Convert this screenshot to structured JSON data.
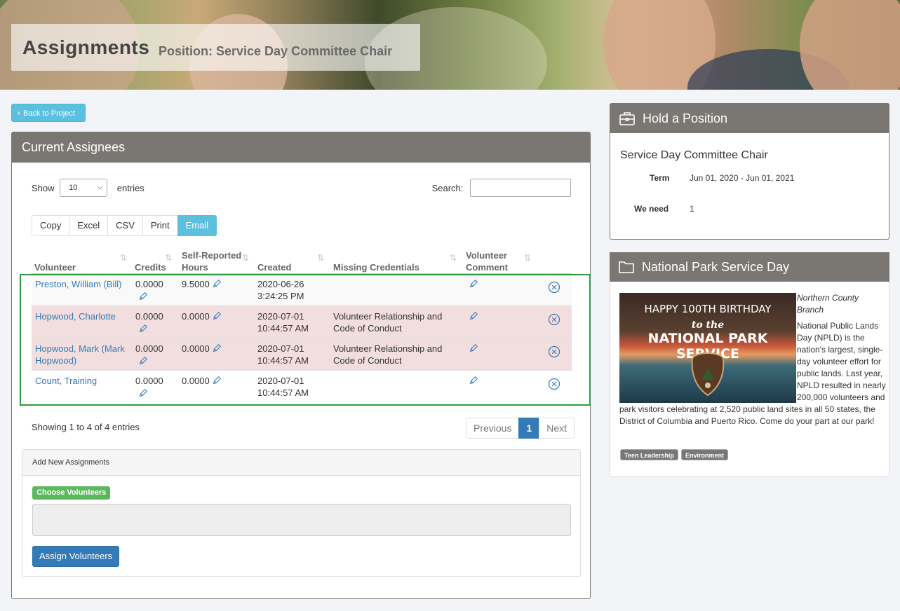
{
  "header": {
    "title": "Assignments",
    "subtitle": "Position: Service Day Committee Chair"
  },
  "back_button": {
    "label": "Back to Project"
  },
  "assignees_panel": {
    "title": "Current Assignees",
    "show_label": "Show",
    "page_size": "10",
    "entries_label": "entries",
    "search_label": "Search:",
    "export_buttons": [
      "Copy",
      "Excel",
      "CSV",
      "Print",
      "Email"
    ],
    "columns": {
      "volunteer": "Volunteer",
      "credits": "Credits",
      "hours_1": "Self-Reported",
      "hours_2": "Hours",
      "created": "Created",
      "missing": "Missing Credentials",
      "comment_1": "Volunteer",
      "comment_2": "Comment"
    },
    "rows": [
      {
        "volunteer_1": "Preston, William (Bill)",
        "volunteer_2": "",
        "credits": "0.0000",
        "hours": "9.5000",
        "created_1": "2020-06-26",
        "created_2": "3:24:25 PM",
        "missing_1": "",
        "missing_2": "",
        "status": "ok"
      },
      {
        "volunteer_1": "Hopwood, Charlotte",
        "volunteer_2": "",
        "credits": "0.0000",
        "hours": "0.0000",
        "created_1": "2020-07-01",
        "created_2": "10:44:57 AM",
        "missing_1": "Volunteer Relationship and",
        "missing_2": "Code of Conduct",
        "status": "missing"
      },
      {
        "volunteer_1": "Hopwood, Mark (Mark",
        "volunteer_2": "Hopwood)",
        "credits": "0.0000",
        "hours": "0.0000",
        "created_1": "2020-07-01",
        "created_2": "10:44:57 AM",
        "missing_1": "Volunteer Relationship and",
        "missing_2": "Code of Conduct",
        "status": "missing"
      },
      {
        "volunteer_1": "Count, Training",
        "volunteer_2": "",
        "credits": "0.0000",
        "hours": "0.0000",
        "created_1": "2020-07-01",
        "created_2": "10:44:57 AM",
        "missing_1": "",
        "missing_2": "",
        "status": "ok"
      }
    ],
    "showing_text": "Showing 1 to 4 of 4 entries",
    "pager": {
      "previous": "Previous",
      "current": "1",
      "next": "Next"
    },
    "add_new": {
      "title": "Add New Assignments",
      "choose_label": "Choose Volunteers",
      "assign_label": "Assign Volunteers"
    }
  },
  "hold_position": {
    "title": "Hold a Position",
    "position_name": "Service Day Committee Chair",
    "term_label": "Term",
    "term_value": "Jun 01, 2020 - Jun 01, 2021",
    "need_label": "We need",
    "need_value": "1"
  },
  "project": {
    "title": "National Park Service Day",
    "image_line1": "HAPPY 100TH BIRTHDAY",
    "image_line2": "to the",
    "image_line3": "NATIONAL PARK SERVICE",
    "org_1": "Northern County",
    "org_2": "Branch",
    "description": "National Public Lands Day (NPLD) is the nation's largest, single-day volunteer effort for public lands. Last year, NPLD resulted in nearly 200,000 volunteers and park visitors celebrating at 2,520 public land sites in all 50 states, the District of Columbia and Puerto Rico. Come do your part at our park!",
    "tags": [
      "Teen Leadership",
      "Environment"
    ]
  },
  "colors": {
    "panel_header": "#7a7671",
    "info": "#5bc0de",
    "primary": "#337ab7",
    "success": "#5cb85c",
    "missing_row": "#f2dede",
    "highlight_frame": "#2e9b3f"
  }
}
